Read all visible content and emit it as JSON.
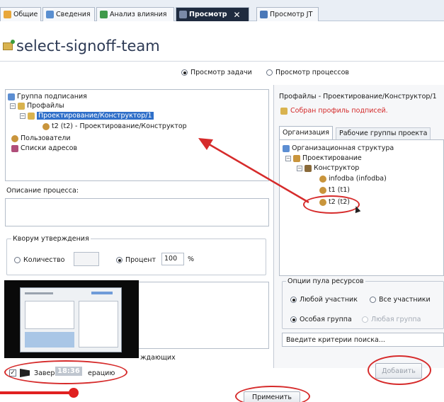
{
  "tabs": [
    {
      "label": "Общие",
      "icon": "general-tab-icon"
    },
    {
      "label": "Сведения",
      "icon": "details-tab-icon"
    },
    {
      "label": "Анализ влияния",
      "icon": "impact-analysis-tab-icon"
    },
    {
      "label": "Просмотр",
      "icon": "preview-tab-icon",
      "close": "✕"
    },
    {
      "label": "Просмотр JT",
      "icon": "jt-preview-tab-icon"
    }
  ],
  "title": "select-signoff-team",
  "view_mode": {
    "task_view": "Просмотр задачи",
    "process_view": "Просмотр процессов",
    "selected": "task_view"
  },
  "signoff_tree": {
    "root": "Группа подписания",
    "profiles": "Профайлы",
    "profile_item": "Проектирование/Конструктор/1",
    "assigned_member": "t2 (t2) - Проектирование/Конструктор",
    "users": "Пользователи",
    "address_lists": "Списки адресов"
  },
  "process_description": {
    "label": "Описание процесса:",
    "value": ""
  },
  "quorum": {
    "title": "Кворум утверждения",
    "count_label": "Количество",
    "count_value": "",
    "percent_label": "Процент",
    "percent_value": "100",
    "percent_unit": "%"
  },
  "partial_label": "ждающих",
  "finish_checkbox": {
    "label_start": "Завер",
    "label_end": "ерацию",
    "checked": true
  },
  "video_timestamp": "18:36",
  "apply_button": "Применить",
  "right_panel": {
    "header": "Профайлы - Проектирование/Конструктор/1",
    "status": "Собран профиль подписей.",
    "tabs": [
      "Организация",
      "Рабочие группы проекта"
    ],
    "active_tab": 0,
    "org_tree": {
      "root": "Организационная структура",
      "group": "Проектирование",
      "role": "Конструктор",
      "members": [
        "infodba (infodba)",
        "t1 (t1)",
        "t2 (t2)"
      ]
    },
    "pool_options": {
      "title": "Опции пула ресурсов",
      "any_participant": "Любой участник",
      "all_participants": "Все участники",
      "special_group": "Особая группа",
      "any_group": "Любая группа"
    },
    "search_placeholder": "Введите критерии поиска...",
    "add_button": "Добавить"
  },
  "colors": {
    "annotation_red": "#d62b2b",
    "selection_blue": "#2f6fc9",
    "status_red": "#d42a2a",
    "active_tab_bg": "#1f2b3f"
  }
}
